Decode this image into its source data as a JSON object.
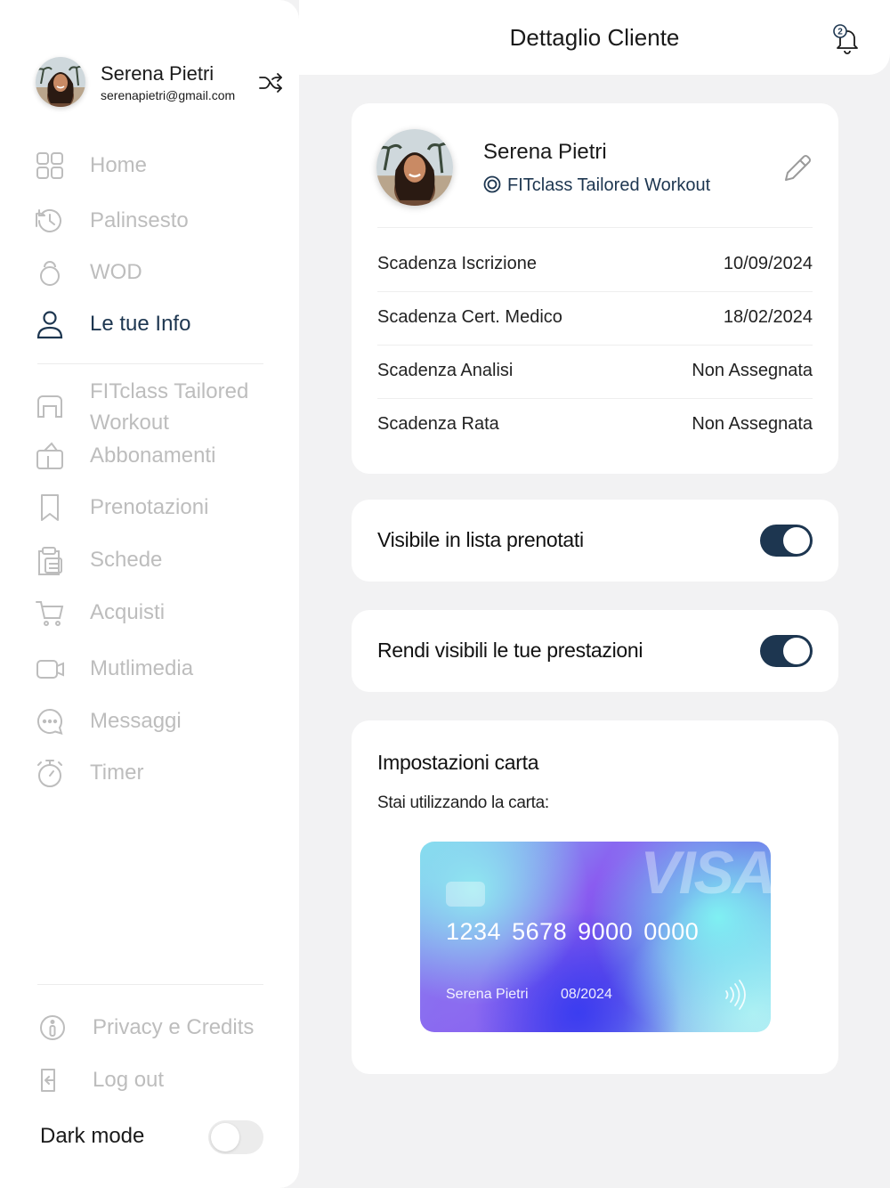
{
  "sidebar": {
    "profile": {
      "name": "Serena Pietri",
      "email": "serenapietri@gmail.com"
    },
    "items": [
      {
        "label": "Home",
        "icon": "home-grid-icon",
        "active": false
      },
      {
        "label": "Palinsesto",
        "icon": "history-icon",
        "active": false
      },
      {
        "label": "WOD",
        "icon": "kettlebell-icon",
        "active": false
      },
      {
        "label": "Le tue Info",
        "icon": "user-icon",
        "active": true
      },
      {
        "label": "FITclass Tailored Workout",
        "icon": "arch-icon",
        "active": false
      },
      {
        "label": "Abbonamenti",
        "icon": "tag-icon",
        "active": false
      },
      {
        "label": "Prenotazioni",
        "icon": "bookmark-icon",
        "active": false
      },
      {
        "label": "Schede",
        "icon": "clipboard-icon",
        "active": false
      },
      {
        "label": "Acquisti",
        "icon": "cart-icon",
        "active": false
      },
      {
        "label": "Mutlimedia",
        "icon": "video-icon",
        "active": false
      },
      {
        "label": "Messaggi",
        "icon": "chat-icon",
        "active": false
      },
      {
        "label": "Timer",
        "icon": "stopwatch-icon",
        "active": false
      }
    ],
    "footer": [
      {
        "label": "Privacy e Credits",
        "icon": "info-icon"
      },
      {
        "label": "Log out",
        "icon": "logout-icon"
      }
    ],
    "dark_mode": {
      "label": "Dark mode",
      "enabled": false
    }
  },
  "header": {
    "title": "Dettaglio Cliente",
    "notifications": "2"
  },
  "client": {
    "name": "Serena Pietri",
    "plan": "FITclass Tailored Workout",
    "rows": [
      {
        "label": "Scadenza Iscrizione",
        "value": "10/09/2024"
      },
      {
        "label": "Scadenza Cert. Medico",
        "value": "18/02/2024"
      },
      {
        "label": "Scadenza Analisi",
        "value": "Non Assegnata"
      },
      {
        "label": "Scadenza Rata",
        "value": "Non Assegnata"
      }
    ]
  },
  "toggles": [
    {
      "label": "Visibile in lista prenotati",
      "enabled": true
    },
    {
      "label": "Rendi visibili le tue prestazioni",
      "enabled": true
    }
  ],
  "card_settings": {
    "title": "Impostazioni carta",
    "subtitle": "Stai utilizzando la carta:",
    "card": {
      "brand": "VISA",
      "number": "1234 5678 9000 0000",
      "holder": "Serena Pietri",
      "expiry": "08/2024"
    }
  },
  "colors": {
    "accent": "#1d3650",
    "inactive": "#bdbdbd",
    "background": "#f2f2f3"
  }
}
